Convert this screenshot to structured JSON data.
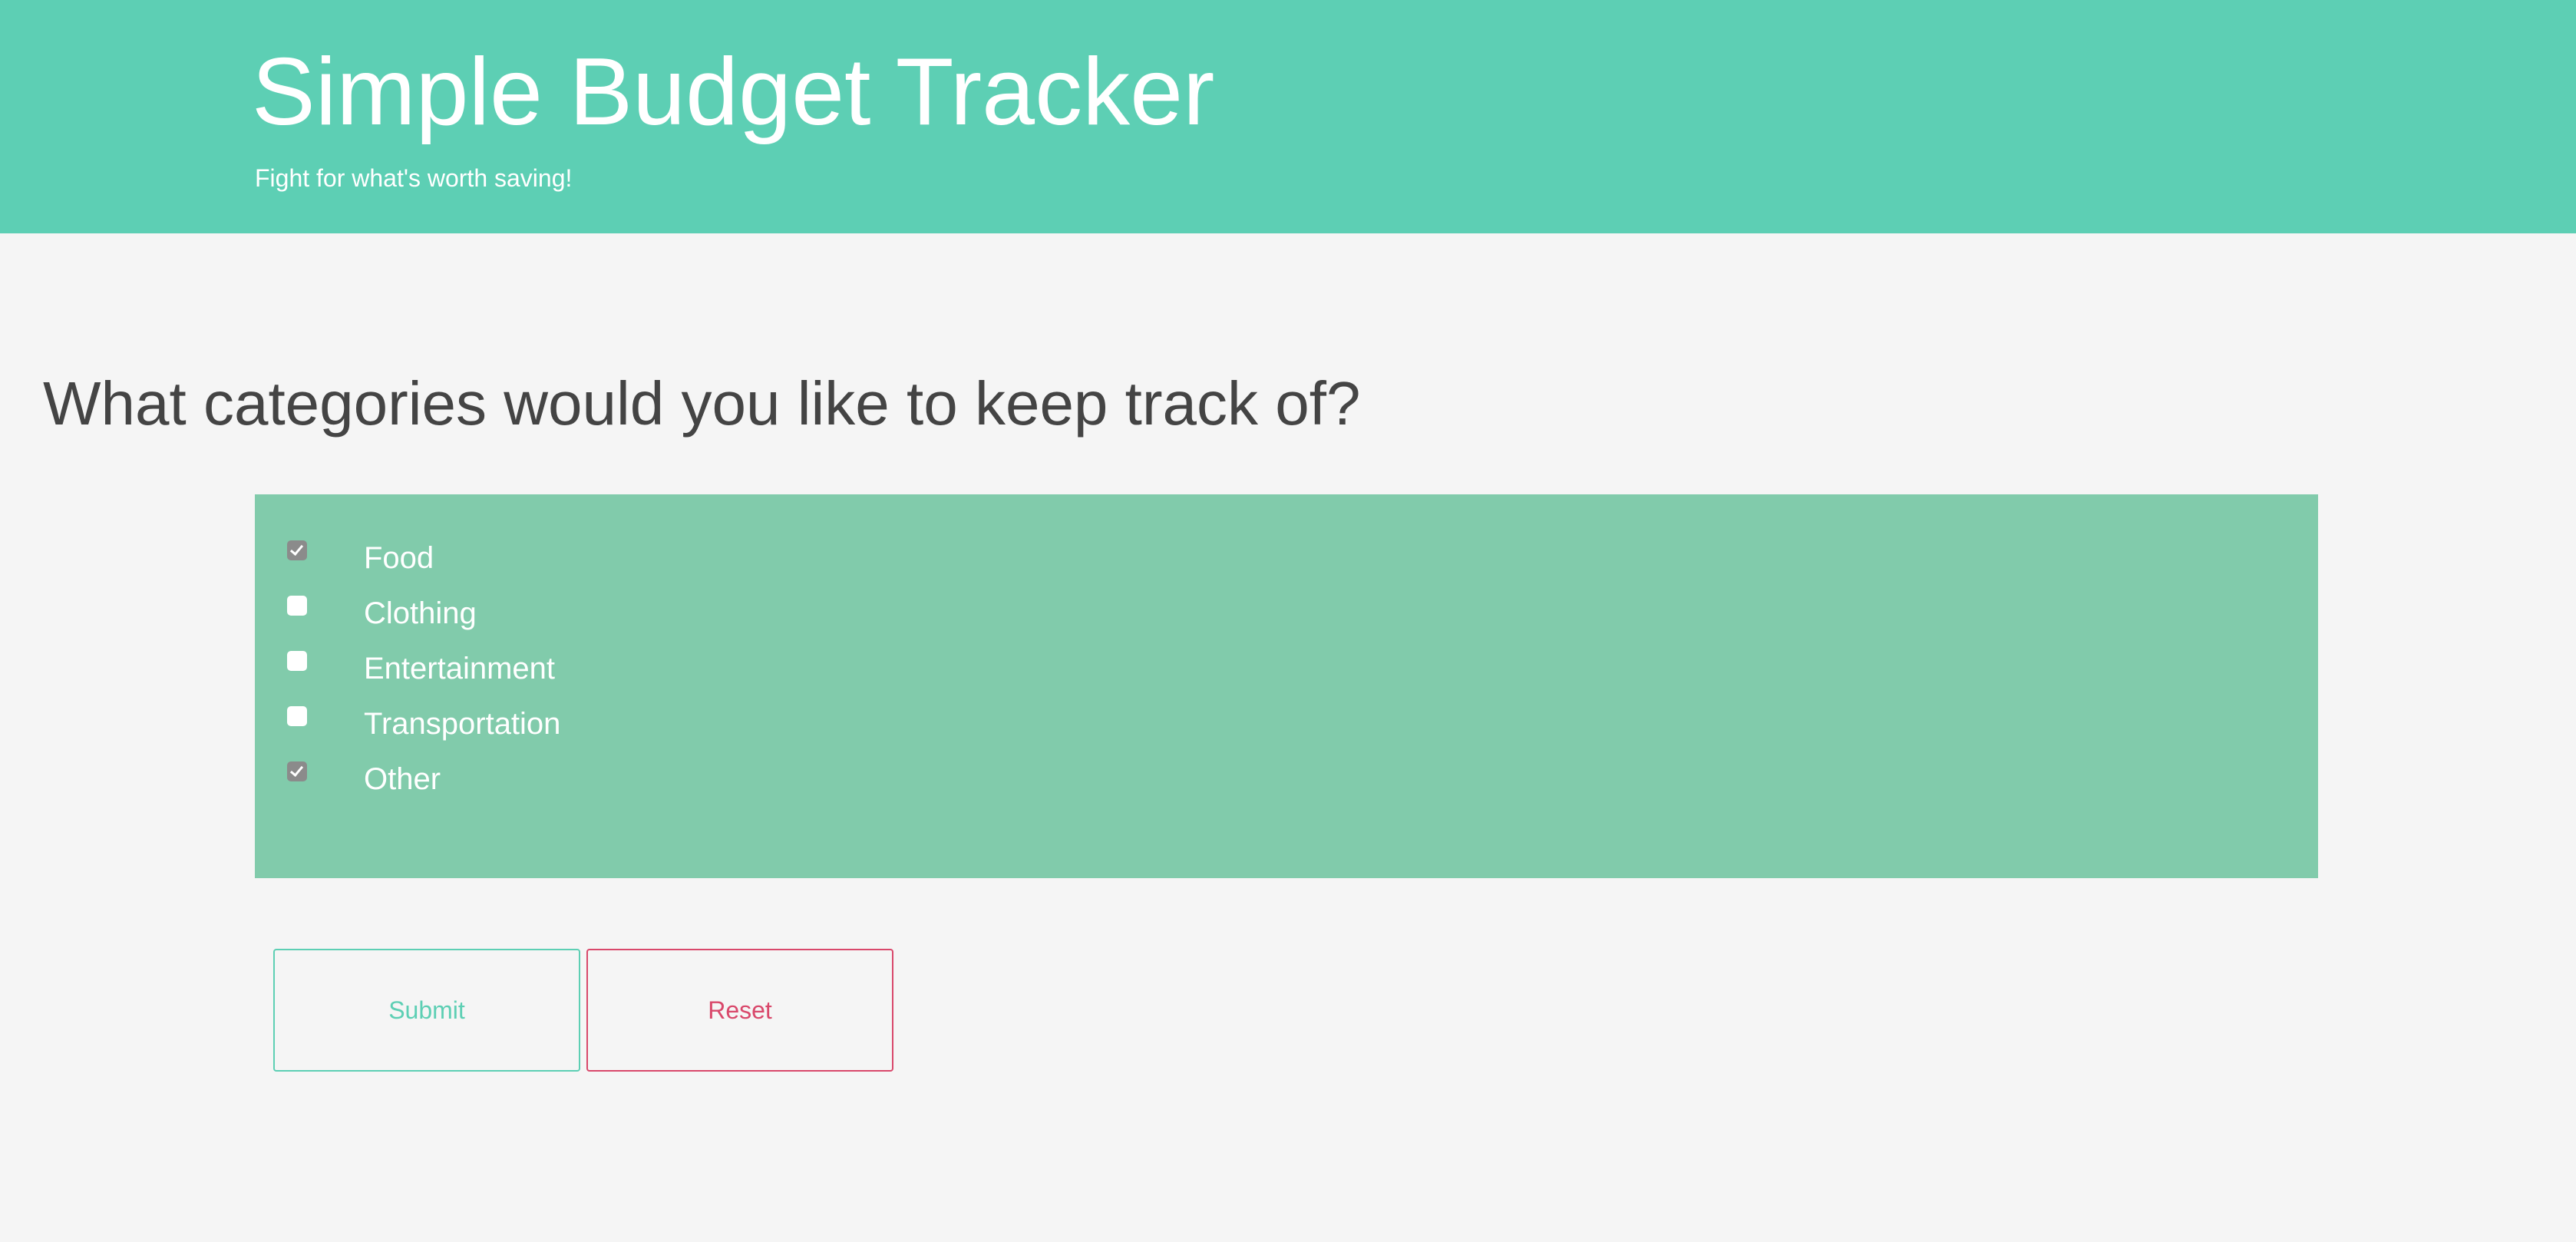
{
  "header": {
    "title": "Simple Budget Tracker",
    "subtitle": "Fight for what's worth saving!"
  },
  "question": "What categories would you like to keep track of?",
  "categories": [
    {
      "label": "Food",
      "checked": true
    },
    {
      "label": "Clothing",
      "checked": false
    },
    {
      "label": "Entertainment",
      "checked": false
    },
    {
      "label": "Transportation",
      "checked": false
    },
    {
      "label": "Other",
      "checked": true
    }
  ],
  "buttons": {
    "submit_label": "Submit",
    "reset_label": "Reset"
  },
  "colors": {
    "header_bg": "#5dcfb4",
    "panel_bg": "#81cbab",
    "page_bg": "#f5f5f5",
    "submit": "#5dcfb4",
    "reset": "#d9486b"
  }
}
